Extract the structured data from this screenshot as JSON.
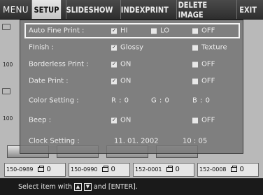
{
  "menu": {
    "title": "MENU",
    "tabs": [
      {
        "label": "SETUP",
        "active": true
      },
      {
        "label": "SLIDESHOW",
        "active": false
      },
      {
        "label": "INDEXPRINT",
        "active": false
      },
      {
        "label": "DELETE IMAGE",
        "active": false
      },
      {
        "label": "EXIT",
        "active": false
      }
    ]
  },
  "side_labels": [
    "100",
    "100"
  ],
  "thumbnails": [
    {
      "name": "150-0989",
      "qty": "0"
    },
    {
      "name": "150-0990",
      "qty": "0"
    },
    {
      "name": "152-0001",
      "qty": "0"
    },
    {
      "name": "152-0008",
      "qty": "0"
    }
  ],
  "settings": {
    "auto_fine_print": {
      "label": "Auto Fine Print :",
      "options": [
        "HI",
        "LO",
        "OFF"
      ],
      "selected": "HI"
    },
    "finish": {
      "label": "FInish :",
      "options": [
        "Glossy",
        "Texture"
      ],
      "selected": "Glossy"
    },
    "borderless_print": {
      "label": "Borderless Print :",
      "options": [
        "ON",
        "OFF"
      ],
      "selected": "ON"
    },
    "date_print": {
      "label": "Date Print :",
      "options": [
        "ON",
        "OFF"
      ],
      "selected": "ON"
    },
    "color_setting": {
      "label": "Color Setting :",
      "r": "R :  0",
      "g": "G :  0",
      "b": "B :  0"
    },
    "beep": {
      "label": "Beep :",
      "options": [
        "ON",
        "OFF"
      ],
      "selected": "ON"
    },
    "clock_setting": {
      "label": "Clock Setting :",
      "date": "11. 01. 2002",
      "time": "10 : 05"
    }
  },
  "status": {
    "prefix": "Select item with",
    "up_icon": "up-arrow-key-icon",
    "down_icon": "down-arrow-key-icon",
    "suffix": "and [ENTER]."
  },
  "colors": {
    "menubar": "#2e2e2e",
    "active_tab": "#d4d4d4",
    "panel": "#767676",
    "selection_border": "#f4f4f4"
  }
}
